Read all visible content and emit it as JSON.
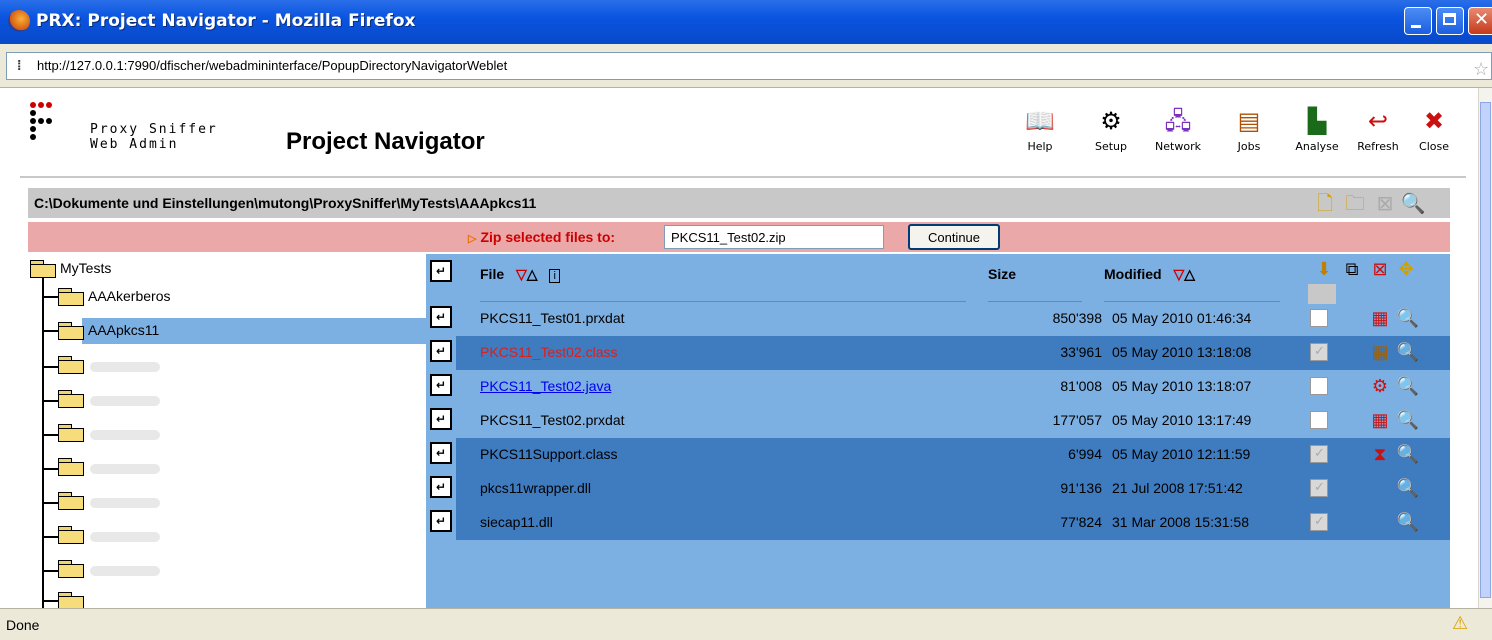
{
  "window": {
    "title": "PRX: Project Navigator - Mozilla Firefox"
  },
  "browser": {
    "url": "http://127.0.0.1:7990/dfischer/webadmininterface/PopupDirectoryNavigatorWeblet",
    "status": "Done"
  },
  "header": {
    "brand_line1": "Proxy Sniffer",
    "brand_line2": "Web Admin",
    "page_title": "Project Navigator",
    "tools": [
      {
        "label": "Help",
        "icon": "book-icon"
      },
      {
        "label": "Setup",
        "icon": "gear-icon"
      },
      {
        "label": "Network",
        "icon": "network-icon"
      },
      {
        "label": "Jobs",
        "icon": "jobs-icon"
      },
      {
        "label": "Analyse",
        "icon": "chart-icon"
      },
      {
        "label": "Refresh",
        "icon": "refresh-icon"
      },
      {
        "label": "Close",
        "icon": "close-icon"
      }
    ]
  },
  "path": "C:\\Dokumente und Einstellungen\\mutong\\ProxySniffer\\MyTests\\AAApkcs11",
  "zip": {
    "label": "Zip selected files to:",
    "filename": "PKCS11_Test02.zip",
    "continue_label": "Continue"
  },
  "tree": {
    "root": "MyTests",
    "children": [
      "AAAkerberos",
      "AAApkcs11"
    ]
  },
  "table": {
    "headers": {
      "file": "File",
      "size": "Size",
      "modified": "Modified"
    },
    "rows": [
      {
        "name": "PKCS11_Test01.prxdat",
        "size": "850'398",
        "modified": "05 May 2010 01:46:34"
      },
      {
        "name": "PKCS11_Test02.class",
        "size": "33'961",
        "modified": "05 May 2010 13:18:08"
      },
      {
        "name": "PKCS11_Test02.java",
        "size": "81'008",
        "modified": "05 May 2010 13:18:07"
      },
      {
        "name": "PKCS11_Test02.prxdat",
        "size": "177'057",
        "modified": "05 May 2010 13:17:49"
      },
      {
        "name": "PKCS11Support.class",
        "size": "6'994",
        "modified": "05 May 2010 12:11:59"
      },
      {
        "name": "pkcs11wrapper.dll",
        "size": "91'136",
        "modified": "21 Jul 2008 17:51:42"
      },
      {
        "name": "siecap11.dll",
        "size": "77'824",
        "modified": "31 Mar 2008 15:31:58"
      }
    ]
  },
  "colors": {
    "table_bg": "#7cafe2",
    "row_dark": "#3f7bbf",
    "zip_bar": "#eba8a8",
    "error_text": "#cc0000",
    "link": "#0000ee"
  }
}
